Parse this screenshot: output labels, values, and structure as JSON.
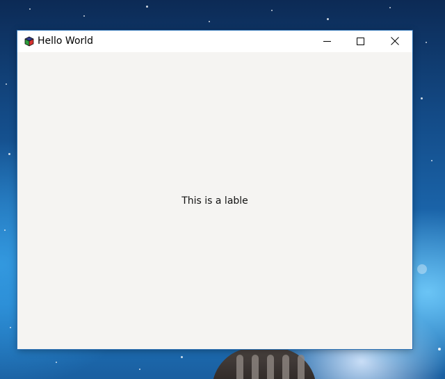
{
  "window": {
    "title": "Hello World",
    "app_icon": "cube-icon",
    "controls": {
      "minimize_icon": "minimize-icon",
      "maximize_icon": "maximize-icon",
      "close_icon": "close-icon"
    }
  },
  "content": {
    "label": "This is a lable"
  },
  "colors": {
    "titlebar": "#ffffff",
    "client_background": "#f5f4f2",
    "text": "#111111"
  }
}
